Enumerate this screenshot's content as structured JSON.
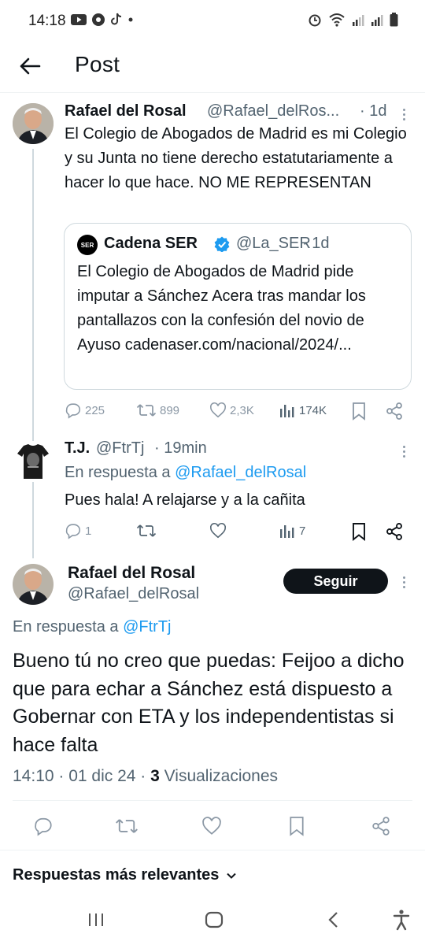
{
  "status_bar": {
    "time": "14:18"
  },
  "header": {
    "title": "Post"
  },
  "tweet1": {
    "name": "Rafael del Rosal",
    "handle": "@Rafael_delRos...",
    "time": "· 1d",
    "text": "El Colegio de Abogados de Madrid es mi Colegio y su Junta no tiene derecho estatutariamente a hacer lo que hace. NO ME REPRESENTAN",
    "quote": {
      "source_name": "Cadena SER",
      "source_handle": "@La_SER",
      "source_time": "· 1d",
      "logo_text": "SER",
      "text": "El Colegio de Abogados de Madrid pide imputar a Sánchez Acera tras mandar los pantallazos con la confesión del novio de Ayuso cadenaser.com/nacional/2024/..."
    },
    "actions": {
      "replies": "225",
      "retweets": "899",
      "likes": "2,3K",
      "views": "174K"
    }
  },
  "tweet2": {
    "name": "T.J.",
    "handle": "@FtrTj",
    "time": "· 19min",
    "reply_prefix": "En respuesta a",
    "reply_to": "@Rafael_delRosal",
    "text": "Pues hala! A relajarse y a la cañita",
    "actions": {
      "replies": "1",
      "views": "7"
    }
  },
  "main_tweet": {
    "name": "Rafael del Rosal",
    "handle": "@Rafael_delRosal",
    "follow_label": "Seguir",
    "reply_prefix": "En respuesta a",
    "reply_to": "@FtrTj",
    "text": "Bueno tú no creo que puedas: Feijoo a dicho que para echar a Sánchez está dispuesto a Gobernar con ETA y los independentistas si hace falta",
    "timestamp": "14:10 · 01 dic 24 ·",
    "views_count": "3",
    "views_label": "Visualizaciones"
  },
  "replies_sort": {
    "label": "Respuestas más relevantes"
  },
  "colors": {
    "link": "#1d9bf0",
    "text": "#0f1419",
    "muted": "#536471",
    "verified": "#1d9bf0"
  }
}
